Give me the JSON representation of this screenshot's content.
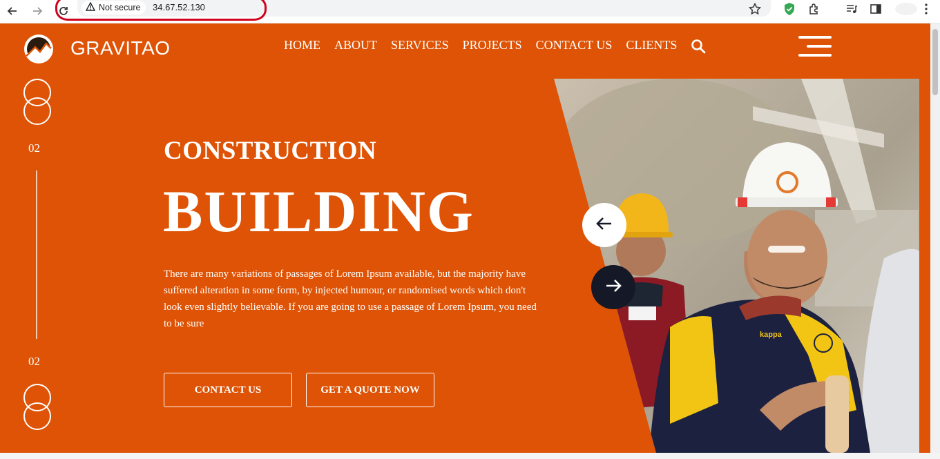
{
  "browser": {
    "security_label": "Not secure",
    "url": "34.67.52.130"
  },
  "site": {
    "brand": "GRAVITAO",
    "nav": [
      "HOME",
      "ABOUT",
      "SERVICES",
      "PROJECTS",
      "CONTACT US",
      "CLIENTS"
    ]
  },
  "slider": {
    "current_index_top": "02",
    "current_index_bottom": "02"
  },
  "hero": {
    "kicker": "CONSTRUCTION",
    "title": "BUILDING",
    "description": "There are many variations of passages of Lorem Ipsum available, but the majority have suffered alteration in some form, by injected humour, or randomised words which don't look even slightly believable. If you are going to use a passage of Lorem Ipsum, you need to be sure",
    "contact_button": "CONTACT US",
    "quote_button": "GET A QUOTE NOW"
  },
  "colors": {
    "brand_orange": "#de5305",
    "dark_navy": "#151826",
    "annotation_red": "#d0021b"
  },
  "icons": {
    "back": "arrow-left-icon",
    "forward": "arrow-right-icon",
    "reload": "reload-icon",
    "warning": "warning-icon",
    "star": "star-icon",
    "search": "search-icon",
    "menu": "hamburger-menu-icon",
    "prev_slide": "arrow-left-icon",
    "next_slide": "arrow-right-icon"
  }
}
